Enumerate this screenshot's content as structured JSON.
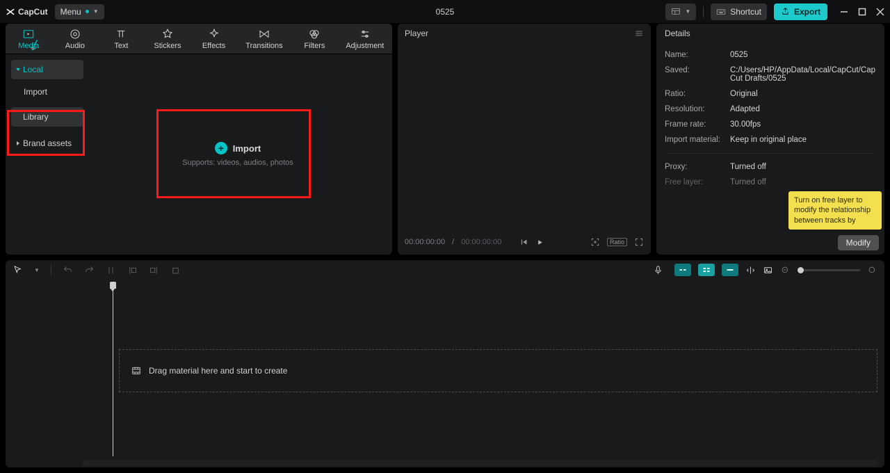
{
  "titlebar": {
    "logo": "CapCut",
    "menu": "Menu",
    "project": "0525",
    "shortcut": "Shortcut",
    "export": "Export"
  },
  "media_tabs": [
    {
      "id": "media",
      "label": "Media"
    },
    {
      "id": "audio",
      "label": "Audio"
    },
    {
      "id": "text",
      "label": "Text"
    },
    {
      "id": "stickers",
      "label": "Stickers"
    },
    {
      "id": "effects",
      "label": "Effects"
    },
    {
      "id": "transitions",
      "label": "Transitions"
    },
    {
      "id": "filters",
      "label": "Filters"
    },
    {
      "id": "adjustment",
      "label": "Adjustment"
    }
  ],
  "media_side": {
    "local": "Local",
    "import": "Import",
    "library": "Library",
    "brand": "Brand assets"
  },
  "import_area": {
    "title": "Import",
    "subtitle": "Supports: videos, audios, photos"
  },
  "player": {
    "title": "Player",
    "time_current": "00:00:00:00",
    "time_total": "00:00:00:00",
    "ratio": "Ratio"
  },
  "details": {
    "title": "Details",
    "rows": {
      "name_k": "Name:",
      "name_v": "0525",
      "saved_k": "Saved:",
      "saved_v": "C:/Users/HP/AppData/Local/CapCut/CapCut Drafts/0525",
      "ratio_k": "Ratio:",
      "ratio_v": "Original",
      "resolution_k": "Resolution:",
      "resolution_v": "Adapted",
      "fps_k": "Frame rate:",
      "fps_v": "30.00fps",
      "importmat_k": "Import material:",
      "importmat_v": "Keep in original place",
      "proxy_k": "Proxy:",
      "proxy_v": "Turned off",
      "freelayer_k": "Free layer:",
      "freelayer_v": "Turned off"
    },
    "tooltip": "Turn on free layer to modify the relationship between tracks by",
    "modify": "Modify"
  },
  "timeline": {
    "drop_hint": "Drag material here and start to create"
  }
}
